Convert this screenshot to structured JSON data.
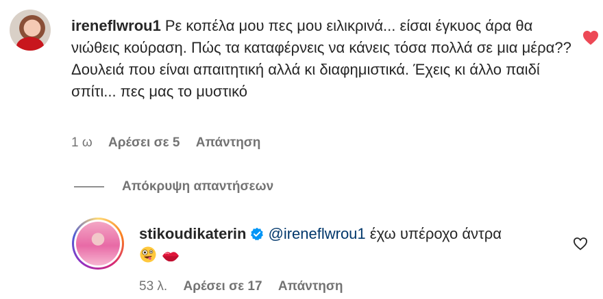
{
  "comment": {
    "username": "ireneflwrou1",
    "text": "Ρε κοπέλα μου πες μου ειλικρινά... είσαι έγκυος άρα θα νιώθεις κούραση. Πώς τα καταφέρνεις να κάνεις τόσα πολλά σε μια μέρα?? Δουλειά που είναι απαιτητική αλλά κι διαφημιστικά. Έχεις κι άλλο παιδί σπίτι... πες μας το μυστικό",
    "time": "1 ω",
    "likes": "Αρέσει σε 5",
    "reply_label": "Απάντηση",
    "liked": true
  },
  "hide_replies_label": "Απόκρυψη απαντήσεων",
  "reply": {
    "username": "stikoudikaterin",
    "verified": true,
    "mention": "@ireneflwrou1",
    "text": "έχω υπέροχο άντρα",
    "emojis": [
      "zany-face-emoji",
      "kiss-mark-emoji"
    ],
    "time": "53 λ.",
    "likes": "Αρέσει σε 17",
    "reply_label": "Απάντηση",
    "liked": false
  },
  "colors": {
    "text": "#262626",
    "meta": "#737373",
    "mention": "#00376b",
    "like": "#ed4956",
    "verified": "#0095f6"
  }
}
